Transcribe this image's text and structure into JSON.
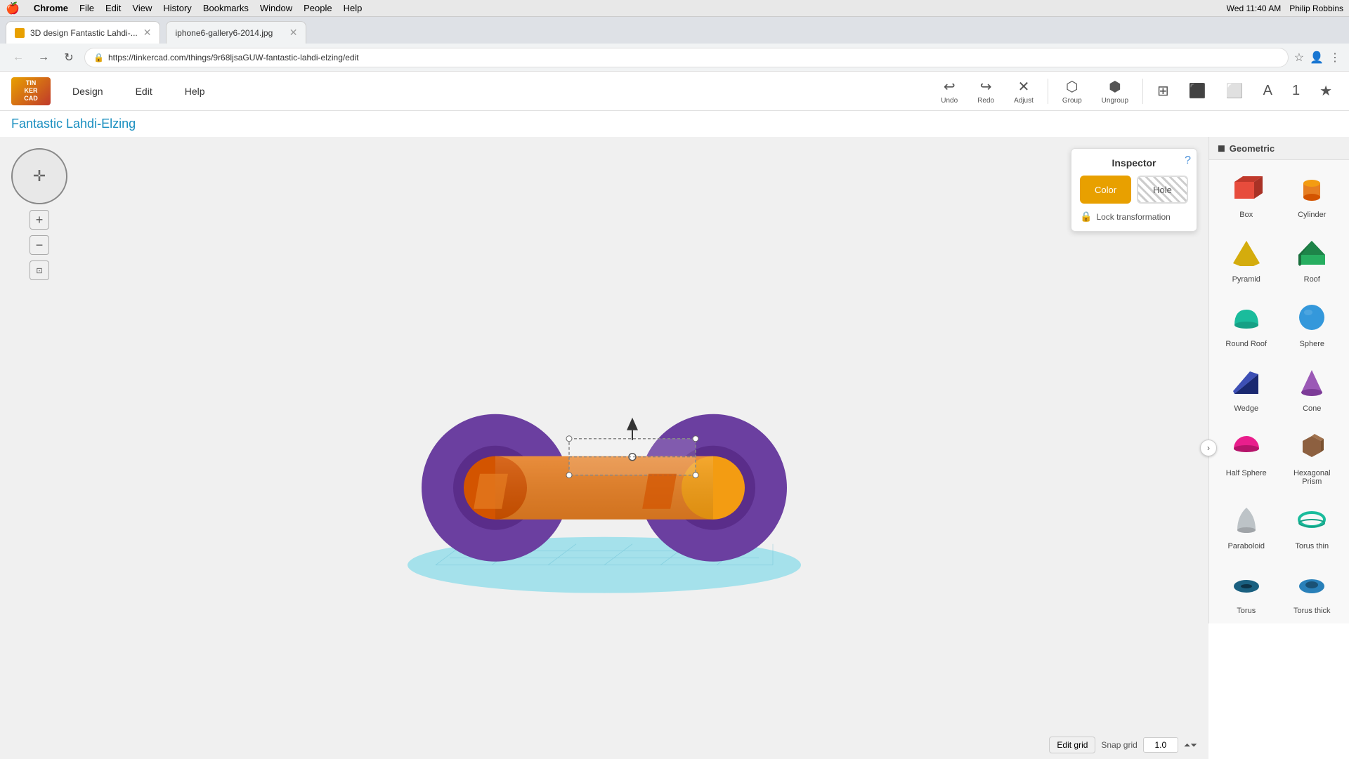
{
  "menubar": {
    "apple": "🍎",
    "items": [
      "Chrome",
      "File",
      "Edit",
      "View",
      "History",
      "Bookmarks",
      "Window",
      "People",
      "Help"
    ],
    "right": {
      "datetime": "Wed 11:40 AM",
      "user": "Philip Robbins"
    }
  },
  "tabs": [
    {
      "id": "tab1",
      "favicon": true,
      "label": "3D design Fantastic Lahdi-...",
      "active": true,
      "closable": true
    },
    {
      "id": "tab2",
      "favicon": false,
      "label": "iphone6-gallery6-2014.jpg",
      "active": false,
      "closable": true
    }
  ],
  "addressbar": {
    "url": "https://tinkercad.com/things/9r68ljsaGUW-fantastic-lahdi-elzing/edit"
  },
  "appheader": {
    "logo": "TIN\nKER\nCAD",
    "menus": [
      "Design",
      "Edit",
      "Help"
    ],
    "toolbar": {
      "undo": "Undo",
      "redo": "Redo",
      "adjust": "Adjust",
      "group": "Group",
      "ungroup": "Ungroup"
    },
    "right_icons": [
      "grid",
      "cube",
      "cube-outline",
      "A",
      "1",
      "star"
    ]
  },
  "project": {
    "title": "Fantastic Lahdi-Elzing"
  },
  "inspector": {
    "title": "Inspector",
    "color_btn": "Color",
    "hole_btn": "Hole",
    "lock_label": "Lock transformation",
    "help": "?"
  },
  "shapes": {
    "header": "Geometric",
    "items": [
      {
        "id": "box",
        "label": "Box",
        "color": "#e74c3c",
        "shape": "box"
      },
      {
        "id": "cylinder",
        "label": "Cylinder",
        "color": "#e67e22",
        "shape": "cylinder"
      },
      {
        "id": "pyramid",
        "label": "Pyramid",
        "color": "#f1c40f",
        "shape": "pyramid"
      },
      {
        "id": "roof",
        "label": "Roof",
        "color": "#27ae60",
        "shape": "roof"
      },
      {
        "id": "round-roof",
        "label": "Round Roof",
        "color": "#1abc9c",
        "shape": "round-roof"
      },
      {
        "id": "sphere",
        "label": "Sphere",
        "color": "#3498db",
        "shape": "sphere"
      },
      {
        "id": "wedge",
        "label": "Wedge",
        "color": "#2c3e8c",
        "shape": "wedge"
      },
      {
        "id": "cone",
        "label": "Cone",
        "color": "#9b59b6",
        "shape": "cone"
      },
      {
        "id": "half-sphere",
        "label": "Half Sphere",
        "color": "#e91e8c",
        "shape": "half-sphere"
      },
      {
        "id": "hex-prism",
        "label": "Hexagonal Prism",
        "color": "#8d6040",
        "shape": "hex-prism"
      },
      {
        "id": "paraboloid",
        "label": "Paraboloid",
        "color": "#bdc3c7",
        "shape": "paraboloid"
      },
      {
        "id": "torus-thin",
        "label": "Torus thin",
        "color": "#1abc9c",
        "shape": "torus-thin"
      },
      {
        "id": "torus",
        "label": "Torus",
        "color": "#1a6080",
        "shape": "torus"
      },
      {
        "id": "torus-thick",
        "label": "Torus thick",
        "color": "#2980b9",
        "shape": "torus-thick"
      }
    ]
  },
  "canvas": {
    "grid_label": "Edit grid",
    "snap_label": "Snap grid",
    "snap_value": "1.0"
  },
  "nav": {
    "zoom_in": "+",
    "zoom_out": "-"
  }
}
